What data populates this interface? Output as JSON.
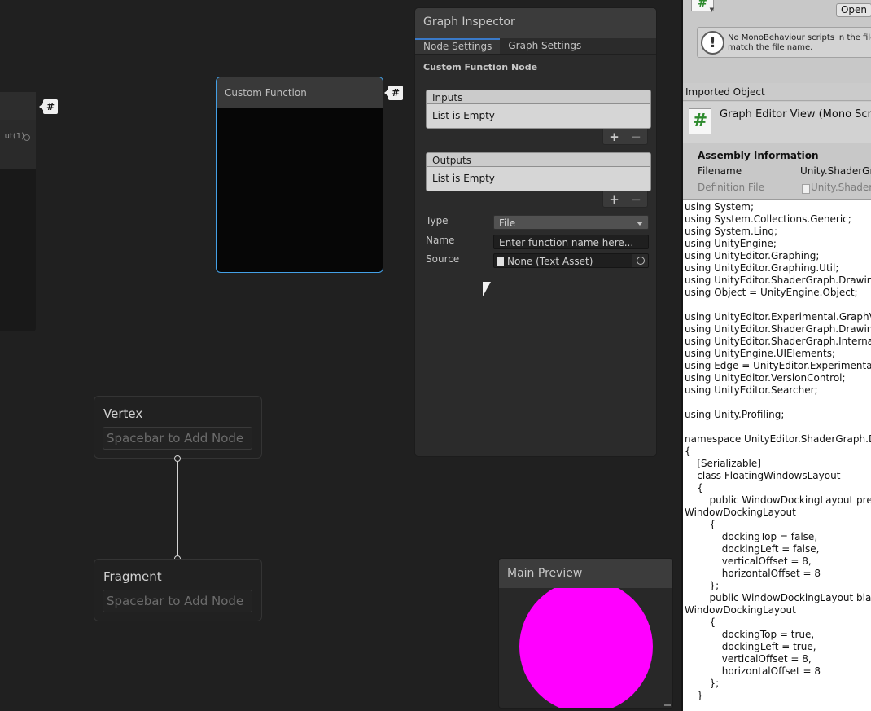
{
  "canvas": {
    "partial_node": {
      "port_label": "ut(1)"
    },
    "custom_function_node": {
      "title": "Custom Function"
    },
    "hash_badge": "#",
    "vertex": {
      "title": "Vertex",
      "hint": "Spacebar to Add Node"
    },
    "fragment": {
      "title": "Fragment",
      "hint": "Spacebar to Add Node"
    }
  },
  "graph_inspector": {
    "title": "Graph Inspector",
    "tabs": [
      {
        "label": "Node Settings",
        "active": true
      },
      {
        "label": "Graph Settings",
        "active": false
      }
    ],
    "section_title": "Custom Function Node",
    "inputs": {
      "header": "Inputs",
      "empty_text": "List is Empty",
      "add": "+",
      "remove": "−"
    },
    "outputs": {
      "header": "Outputs",
      "empty_text": "List is Empty",
      "add": "+",
      "remove": "−"
    },
    "type": {
      "label": "Type",
      "value": "File"
    },
    "name": {
      "label": "Name",
      "placeholder": "Enter function name here..."
    },
    "source": {
      "label": "Source",
      "value": "None (Text Asset)"
    }
  },
  "main_preview": {
    "title": "Main Preview",
    "sphere_color": "#ff00ff"
  },
  "inspector_panel": {
    "open_button": "Open",
    "script_glyph": "#",
    "help_icon": "!",
    "help_message": "No MonoBehaviour scripts in the file, match the file name.",
    "imported_object": "Imported Object",
    "object_title": "Graph Editor View (Mono Scri",
    "assembly": {
      "title": "Assembly Information",
      "filename_label": "Filename",
      "filename_value": "Unity.ShaderGr",
      "definition_label": "Definition File",
      "definition_value": "Unity.Shader"
    },
    "code": "using System;\nusing System.Collections.Generic;\nusing System.Linq;\nusing UnityEngine;\nusing UnityEditor.Graphing;\nusing UnityEditor.Graphing.Util;\nusing UnityEditor.ShaderGraph.Drawing.I\nusing Object = UnityEngine.Object;\n\nusing UnityEditor.Experimental.GraphView\nusing UnityEditor.ShaderGraph.Drawing.C\nusing UnityEditor.ShaderGraph.Internal;\nusing UnityEngine.UIElements;\nusing Edge = UnityEditor.Experimental.Gr\nusing UnityEditor.VersionControl;\nusing UnityEditor.Searcher;\n\nusing Unity.Profiling;\n\nnamespace UnityEditor.ShaderGraph.Dra\n{\n    [Serializable]\n    class FloatingWindowsLayout\n    {\n        public WindowDockingLayout previe\nWindowDockingLayout\n        {\n            dockingTop = false,\n            dockingLeft = false,\n            verticalOffset = 8,\n            horizontalOffset = 8\n        };\n        public WindowDockingLayout blackb\nWindowDockingLayout\n        {\n            dockingTop = true,\n            dockingLeft = true,\n            verticalOffset = 8,\n            horizontalOffset = 8\n        };\n    }"
  },
  "colors": {
    "canvas_bg": "#202020",
    "selection_blue": "#44a0e6",
    "tab_active_accent": "#3a7ac9",
    "preview_sphere": "#ff00ff",
    "script_icon_green": "#2e8b2e"
  }
}
